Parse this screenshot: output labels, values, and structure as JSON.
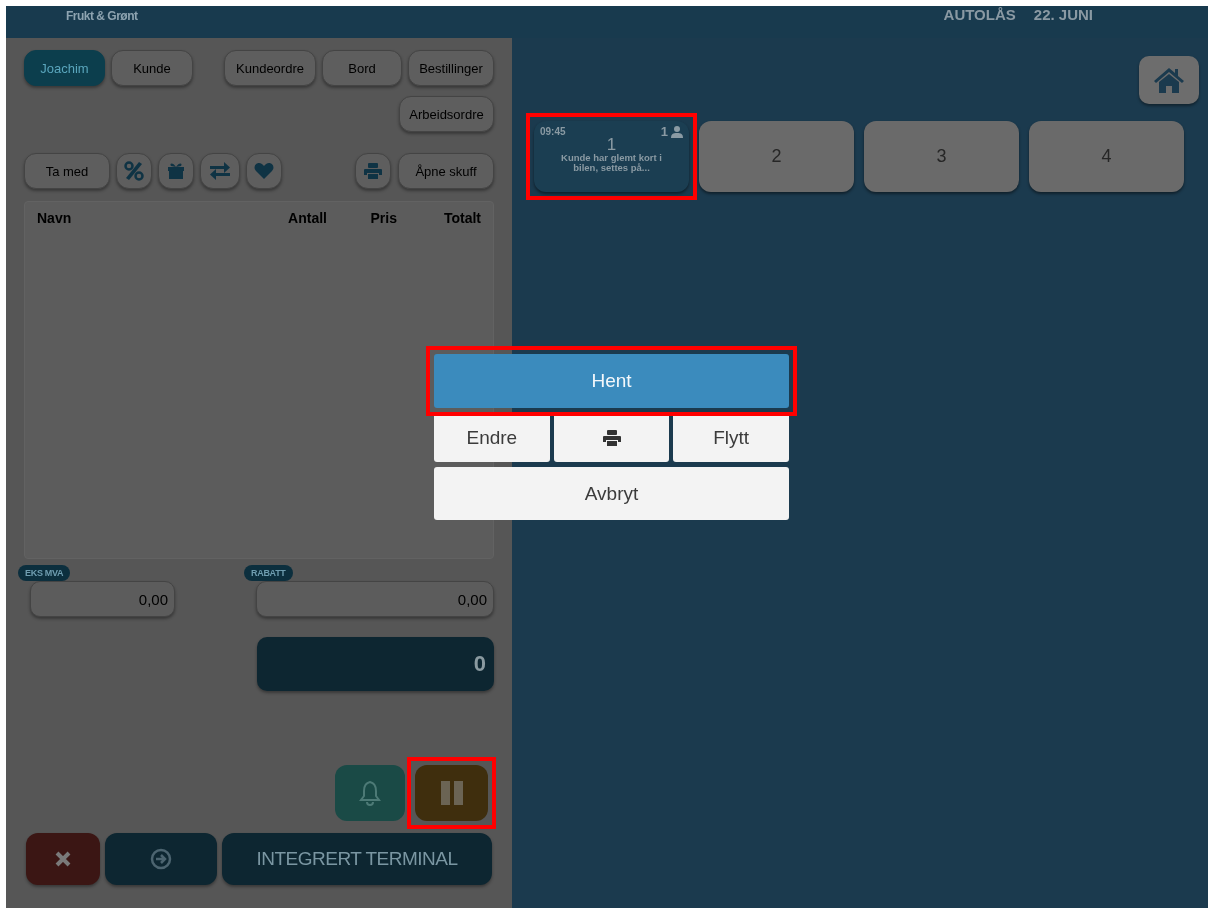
{
  "header": {
    "store_name": "Frukt & Grønt",
    "lock_label": "AUTOLÅS",
    "date": "22. JUNI"
  },
  "order_panel": {
    "nav_buttons": [
      {
        "label": "Joachim",
        "selected": true
      },
      {
        "label": "Kunde",
        "selected": false
      },
      {
        "label": "Kundeordre",
        "selected": false
      },
      {
        "label": "Bord",
        "selected": false
      },
      {
        "label": "Bestillinger",
        "selected": false
      },
      {
        "label": "Arbeidsordre",
        "selected": false
      }
    ],
    "take_away": "Ta med",
    "open_drawer": "Åpne skuff",
    "table": {
      "columns": [
        "Navn",
        "Antall",
        "Pris",
        "Totalt"
      ]
    },
    "excl_vat": {
      "label": "EKS MVA",
      "value": "0,00"
    },
    "discount": {
      "label": "RABATT",
      "value": "0,00"
    },
    "total": "0",
    "pause_highlighted": true,
    "pay_button": "INTEGRERT TERMINAL"
  },
  "tables_area": {
    "tables": [
      {
        "number": "1",
        "kind": "occupied",
        "time": "09:45",
        "guests": "1",
        "note": "Kunde har glemt kort i bilen, settes på...",
        "highlighted": true
      },
      {
        "number": "2",
        "kind": "free",
        "highlighted": false
      },
      {
        "number": "3",
        "kind": "free",
        "highlighted": false
      },
      {
        "number": "4",
        "kind": "free",
        "highlighted": false
      }
    ]
  },
  "dialog": {
    "primary_button": {
      "label": "Hent",
      "highlighted": true
    },
    "buttons": [
      {
        "label": "Endre",
        "kind": "plain"
      },
      {
        "kind": "print"
      },
      {
        "label": "Flytt",
        "kind": "plain"
      }
    ],
    "cancel_button": "Avbryt"
  }
}
